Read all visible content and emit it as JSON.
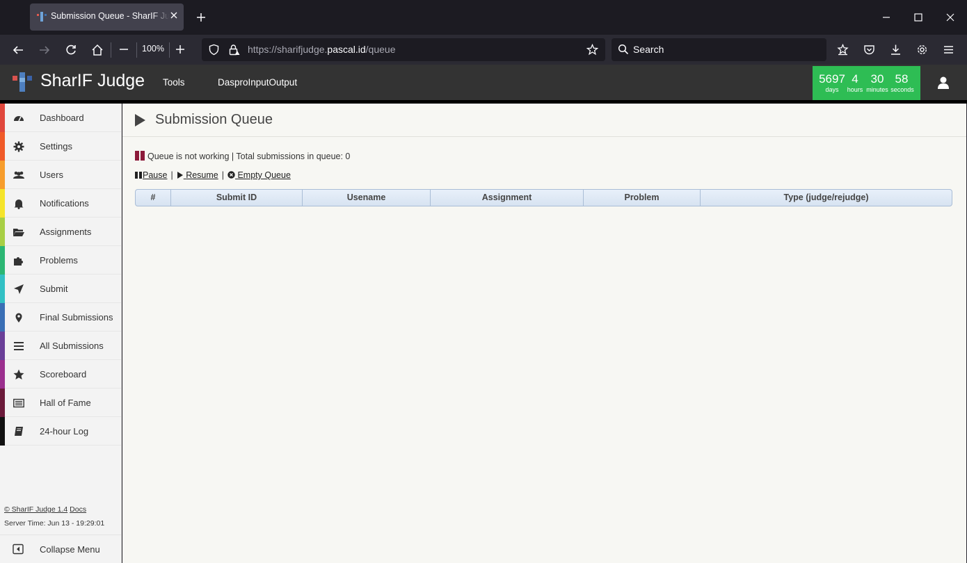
{
  "browser": {
    "tab_title": "Submission Queue - SharIF Judge",
    "url_host": "https://sharifjudge.",
    "url_domain": "pascal.id",
    "url_path": "/queue",
    "zoom": "100%",
    "search_placeholder": "Search"
  },
  "app": {
    "brand": "SharIF Judge",
    "menu": [
      "Tools",
      "DasproInputOutput"
    ],
    "timer": {
      "days": "5697",
      "days_label": "days",
      "hours": "4",
      "hours_label": "hours",
      "minutes": "30",
      "minutes_label": "minutes",
      "seconds": "58",
      "seconds_label": "seconds"
    }
  },
  "sidebar": {
    "items": [
      {
        "label": "Dashboard",
        "icon": "dashboard-icon",
        "color": "#e0473c"
      },
      {
        "label": "Settings",
        "icon": "gear-icon",
        "color": "#f05a28"
      },
      {
        "label": "Users",
        "icon": "users-icon",
        "color": "#f79d2c"
      },
      {
        "label": "Notifications",
        "icon": "bell-icon",
        "color": "#f5e42a"
      },
      {
        "label": "Assignments",
        "icon": "folder-icon",
        "color": "#a8cf45"
      },
      {
        "label": "Problems",
        "icon": "puzzle-icon",
        "color": "#2bb673"
      },
      {
        "label": "Submit",
        "icon": "send-icon",
        "color": "#32c0c4"
      },
      {
        "label": "Final Submissions",
        "icon": "map-marker-icon",
        "color": "#3a6fb5"
      },
      {
        "label": "All Submissions",
        "icon": "list-icon",
        "color": "#6a3f98"
      },
      {
        "label": "Scoreboard",
        "icon": "star-icon",
        "color": "#9b2f8e"
      },
      {
        "label": "Hall of Fame",
        "icon": "newspaper-icon",
        "color": "#6b1a3a"
      },
      {
        "label": "24-hour Log",
        "icon": "book-icon",
        "color": "#111111"
      }
    ],
    "footer_copy": "© SharIF Judge 1.4",
    "footer_docs": "Docs",
    "server_time": "Server Time: Jun 13 - 19:29:01",
    "collapse_label": "Collapse Menu"
  },
  "page": {
    "title": "Submission Queue",
    "status": "Queue is not working | Total submissions in queue: 0",
    "pause": "Pause",
    "resume": "Resume",
    "empty": "Empty Queue",
    "columns": [
      "#",
      "Submit ID",
      "Usename",
      "Assignment",
      "Problem",
      "Type (judge/rejudge)"
    ]
  },
  "colors": {
    "timer_bg": "#2ebd54",
    "header_bg": "#333333",
    "status_icon": "#8c1a3a"
  }
}
